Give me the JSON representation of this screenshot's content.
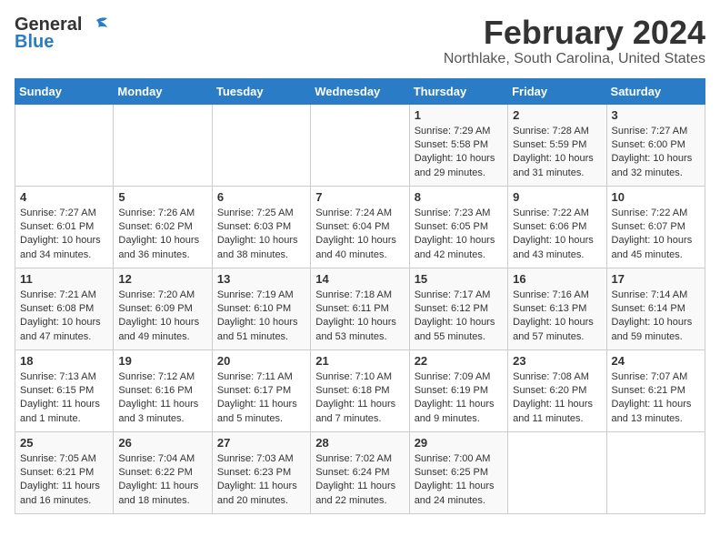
{
  "logo": {
    "line1": "General",
    "line2": "Blue"
  },
  "header": {
    "month": "February 2024",
    "location": "Northlake, South Carolina, United States"
  },
  "weekdays": [
    "Sunday",
    "Monday",
    "Tuesday",
    "Wednesday",
    "Thursday",
    "Friday",
    "Saturday"
  ],
  "weeks": [
    [
      {
        "day": "",
        "info": ""
      },
      {
        "day": "",
        "info": ""
      },
      {
        "day": "",
        "info": ""
      },
      {
        "day": "",
        "info": ""
      },
      {
        "day": "1",
        "info": "Sunrise: 7:29 AM\nSunset: 5:58 PM\nDaylight: 10 hours and 29 minutes."
      },
      {
        "day": "2",
        "info": "Sunrise: 7:28 AM\nSunset: 5:59 PM\nDaylight: 10 hours and 31 minutes."
      },
      {
        "day": "3",
        "info": "Sunrise: 7:27 AM\nSunset: 6:00 PM\nDaylight: 10 hours and 32 minutes."
      }
    ],
    [
      {
        "day": "4",
        "info": "Sunrise: 7:27 AM\nSunset: 6:01 PM\nDaylight: 10 hours and 34 minutes."
      },
      {
        "day": "5",
        "info": "Sunrise: 7:26 AM\nSunset: 6:02 PM\nDaylight: 10 hours and 36 minutes."
      },
      {
        "day": "6",
        "info": "Sunrise: 7:25 AM\nSunset: 6:03 PM\nDaylight: 10 hours and 38 minutes."
      },
      {
        "day": "7",
        "info": "Sunrise: 7:24 AM\nSunset: 6:04 PM\nDaylight: 10 hours and 40 minutes."
      },
      {
        "day": "8",
        "info": "Sunrise: 7:23 AM\nSunset: 6:05 PM\nDaylight: 10 hours and 42 minutes."
      },
      {
        "day": "9",
        "info": "Sunrise: 7:22 AM\nSunset: 6:06 PM\nDaylight: 10 hours and 43 minutes."
      },
      {
        "day": "10",
        "info": "Sunrise: 7:22 AM\nSunset: 6:07 PM\nDaylight: 10 hours and 45 minutes."
      }
    ],
    [
      {
        "day": "11",
        "info": "Sunrise: 7:21 AM\nSunset: 6:08 PM\nDaylight: 10 hours and 47 minutes."
      },
      {
        "day": "12",
        "info": "Sunrise: 7:20 AM\nSunset: 6:09 PM\nDaylight: 10 hours and 49 minutes."
      },
      {
        "day": "13",
        "info": "Sunrise: 7:19 AM\nSunset: 6:10 PM\nDaylight: 10 hours and 51 minutes."
      },
      {
        "day": "14",
        "info": "Sunrise: 7:18 AM\nSunset: 6:11 PM\nDaylight: 10 hours and 53 minutes."
      },
      {
        "day": "15",
        "info": "Sunrise: 7:17 AM\nSunset: 6:12 PM\nDaylight: 10 hours and 55 minutes."
      },
      {
        "day": "16",
        "info": "Sunrise: 7:16 AM\nSunset: 6:13 PM\nDaylight: 10 hours and 57 minutes."
      },
      {
        "day": "17",
        "info": "Sunrise: 7:14 AM\nSunset: 6:14 PM\nDaylight: 10 hours and 59 minutes."
      }
    ],
    [
      {
        "day": "18",
        "info": "Sunrise: 7:13 AM\nSunset: 6:15 PM\nDaylight: 11 hours and 1 minute."
      },
      {
        "day": "19",
        "info": "Sunrise: 7:12 AM\nSunset: 6:16 PM\nDaylight: 11 hours and 3 minutes."
      },
      {
        "day": "20",
        "info": "Sunrise: 7:11 AM\nSunset: 6:17 PM\nDaylight: 11 hours and 5 minutes."
      },
      {
        "day": "21",
        "info": "Sunrise: 7:10 AM\nSunset: 6:18 PM\nDaylight: 11 hours and 7 minutes."
      },
      {
        "day": "22",
        "info": "Sunrise: 7:09 AM\nSunset: 6:19 PM\nDaylight: 11 hours and 9 minutes."
      },
      {
        "day": "23",
        "info": "Sunrise: 7:08 AM\nSunset: 6:20 PM\nDaylight: 11 hours and 11 minutes."
      },
      {
        "day": "24",
        "info": "Sunrise: 7:07 AM\nSunset: 6:21 PM\nDaylight: 11 hours and 13 minutes."
      }
    ],
    [
      {
        "day": "25",
        "info": "Sunrise: 7:05 AM\nSunset: 6:21 PM\nDaylight: 11 hours and 16 minutes."
      },
      {
        "day": "26",
        "info": "Sunrise: 7:04 AM\nSunset: 6:22 PM\nDaylight: 11 hours and 18 minutes."
      },
      {
        "day": "27",
        "info": "Sunrise: 7:03 AM\nSunset: 6:23 PM\nDaylight: 11 hours and 20 minutes."
      },
      {
        "day": "28",
        "info": "Sunrise: 7:02 AM\nSunset: 6:24 PM\nDaylight: 11 hours and 22 minutes."
      },
      {
        "day": "29",
        "info": "Sunrise: 7:00 AM\nSunset: 6:25 PM\nDaylight: 11 hours and 24 minutes."
      },
      {
        "day": "",
        "info": ""
      },
      {
        "day": "",
        "info": ""
      }
    ]
  ]
}
